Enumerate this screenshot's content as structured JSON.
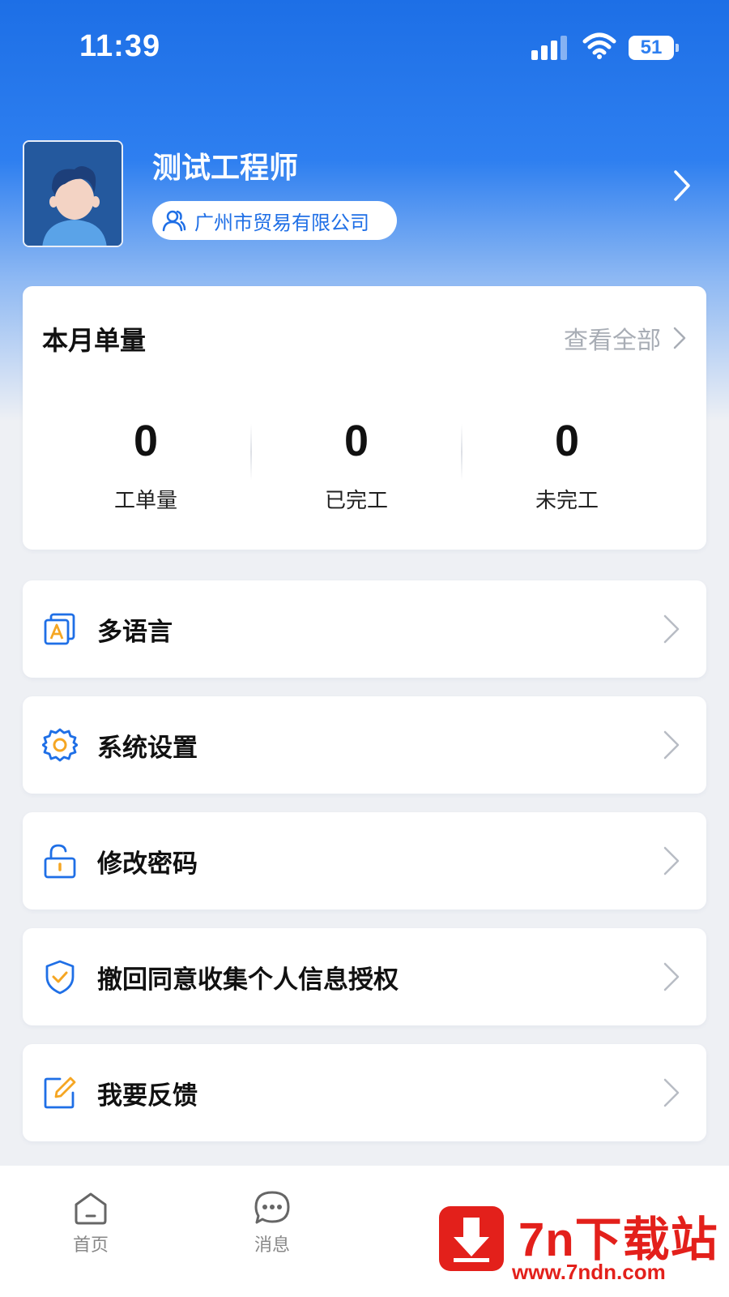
{
  "status_bar": {
    "time": "11:39",
    "battery": "51"
  },
  "profile": {
    "name": "测试工程师",
    "company": "广州市贸易有限公司"
  },
  "stats": {
    "title": "本月单量",
    "view_all": "查看全部",
    "items": [
      {
        "value": "0",
        "label": "工单量"
      },
      {
        "value": "0",
        "label": "已完工"
      },
      {
        "value": "0",
        "label": "未完工"
      }
    ]
  },
  "menu": {
    "items": [
      {
        "label": "多语言",
        "icon": "language-icon"
      },
      {
        "label": "系统设置",
        "icon": "settings-gear-icon"
      },
      {
        "label": "修改密码",
        "icon": "unlock-icon"
      },
      {
        "label": "撤回同意收集个人信息授权",
        "icon": "shield-check-icon"
      },
      {
        "label": "我要反馈",
        "icon": "edit-feedback-icon"
      }
    ]
  },
  "tab_bar": {
    "tabs": [
      {
        "label": "首页",
        "icon": "home-icon"
      },
      {
        "label": "消息",
        "icon": "message-icon"
      }
    ]
  },
  "watermark": {
    "title": "7n下载站",
    "url": "www.7ndn.com"
  },
  "colors": {
    "primary": "#1f6fe6",
    "accent_orange": "#f5a623",
    "watermark_red": "#e3201b"
  }
}
